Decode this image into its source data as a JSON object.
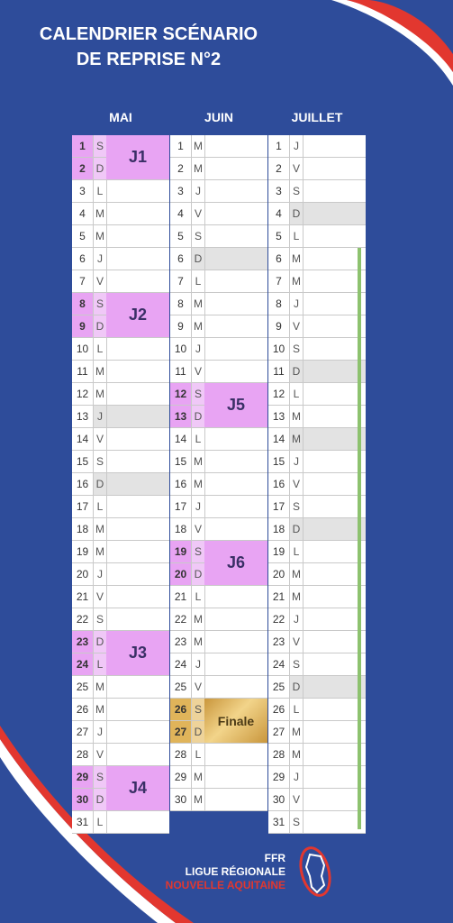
{
  "title": {
    "line1": "CALENDRIER SCÉNARIO",
    "line2": "DE REPRISE N°2"
  },
  "colors": {
    "background": "#2e4c9a",
    "event": "#e8a4f3",
    "finale": "#d9aa4e",
    "weekend_shade": "#e3e3e3",
    "holiday_bar": "#8dc26f"
  },
  "months": [
    {
      "name": "MAI",
      "days": [
        {
          "n": "1",
          "d": "S",
          "hl": true
        },
        {
          "n": "2",
          "d": "D",
          "hl": true
        },
        {
          "n": "3",
          "d": "L"
        },
        {
          "n": "4",
          "d": "M"
        },
        {
          "n": "5",
          "d": "M"
        },
        {
          "n": "6",
          "d": "J"
        },
        {
          "n": "7",
          "d": "V"
        },
        {
          "n": "8",
          "d": "S",
          "hl": true
        },
        {
          "n": "9",
          "d": "D",
          "hl": true
        },
        {
          "n": "10",
          "d": "L"
        },
        {
          "n": "11",
          "d": "M"
        },
        {
          "n": "12",
          "d": "M"
        },
        {
          "n": "13",
          "d": "J",
          "shade": true
        },
        {
          "n": "14",
          "d": "V"
        },
        {
          "n": "15",
          "d": "S"
        },
        {
          "n": "16",
          "d": "D",
          "shade": true
        },
        {
          "n": "17",
          "d": "L"
        },
        {
          "n": "18",
          "d": "M"
        },
        {
          "n": "19",
          "d": "M"
        },
        {
          "n": "20",
          "d": "J"
        },
        {
          "n": "21",
          "d": "V"
        },
        {
          "n": "22",
          "d": "S"
        },
        {
          "n": "23",
          "d": "D",
          "hl": true
        },
        {
          "n": "24",
          "d": "L",
          "hl": true
        },
        {
          "n": "25",
          "d": "M"
        },
        {
          "n": "26",
          "d": "M"
        },
        {
          "n": "27",
          "d": "J"
        },
        {
          "n": "28",
          "d": "V"
        },
        {
          "n": "29",
          "d": "S",
          "hl": true
        },
        {
          "n": "30",
          "d": "D",
          "hl": true
        },
        {
          "n": "31",
          "d": "L"
        }
      ],
      "events": [
        {
          "label": "J1",
          "start": 0
        },
        {
          "label": "J2",
          "start": 7
        },
        {
          "label": "J3",
          "start": 22
        },
        {
          "label": "J4",
          "start": 28
        }
      ]
    },
    {
      "name": "JUIN",
      "days": [
        {
          "n": "1",
          "d": "M"
        },
        {
          "n": "2",
          "d": "M"
        },
        {
          "n": "3",
          "d": "J"
        },
        {
          "n": "4",
          "d": "V"
        },
        {
          "n": "5",
          "d": "S"
        },
        {
          "n": "6",
          "d": "D",
          "shade": true
        },
        {
          "n": "7",
          "d": "L"
        },
        {
          "n": "8",
          "d": "M"
        },
        {
          "n": "9",
          "d": "M"
        },
        {
          "n": "10",
          "d": "J"
        },
        {
          "n": "11",
          "d": "V"
        },
        {
          "n": "12",
          "d": "S",
          "hl": true
        },
        {
          "n": "13",
          "d": "D",
          "hl": true
        },
        {
          "n": "14",
          "d": "L"
        },
        {
          "n": "15",
          "d": "M"
        },
        {
          "n": "16",
          "d": "M"
        },
        {
          "n": "17",
          "d": "J"
        },
        {
          "n": "18",
          "d": "V"
        },
        {
          "n": "19",
          "d": "S",
          "hl": true
        },
        {
          "n": "20",
          "d": "D",
          "hl": true
        },
        {
          "n": "21",
          "d": "L"
        },
        {
          "n": "22",
          "d": "M"
        },
        {
          "n": "23",
          "d": "M"
        },
        {
          "n": "24",
          "d": "J"
        },
        {
          "n": "25",
          "d": "V"
        },
        {
          "n": "26",
          "d": "S",
          "gold": true
        },
        {
          "n": "27",
          "d": "D",
          "gold": true
        },
        {
          "n": "28",
          "d": "L"
        },
        {
          "n": "29",
          "d": "M"
        },
        {
          "n": "30",
          "d": "M"
        }
      ],
      "events": [
        {
          "label": "J5",
          "start": 11
        },
        {
          "label": "J6",
          "start": 18
        },
        {
          "label": "Finale",
          "start": 25,
          "finale": true
        }
      ]
    },
    {
      "name": "JUILLET",
      "days": [
        {
          "n": "1",
          "d": "J"
        },
        {
          "n": "2",
          "d": "V"
        },
        {
          "n": "3",
          "d": "S"
        },
        {
          "n": "4",
          "d": "D",
          "shade": true
        },
        {
          "n": "5",
          "d": "L"
        },
        {
          "n": "6",
          "d": "M"
        },
        {
          "n": "7",
          "d": "M"
        },
        {
          "n": "8",
          "d": "J"
        },
        {
          "n": "9",
          "d": "V"
        },
        {
          "n": "10",
          "d": "S"
        },
        {
          "n": "11",
          "d": "D",
          "shade": true
        },
        {
          "n": "12",
          "d": "L"
        },
        {
          "n": "13",
          "d": "M"
        },
        {
          "n": "14",
          "d": "M",
          "shade": true
        },
        {
          "n": "15",
          "d": "J"
        },
        {
          "n": "16",
          "d": "V"
        },
        {
          "n": "17",
          "d": "S"
        },
        {
          "n": "18",
          "d": "D",
          "shade": true
        },
        {
          "n": "19",
          "d": "L"
        },
        {
          "n": "20",
          "d": "M"
        },
        {
          "n": "21",
          "d": "M"
        },
        {
          "n": "22",
          "d": "J"
        },
        {
          "n": "23",
          "d": "V"
        },
        {
          "n": "24",
          "d": "S"
        },
        {
          "n": "25",
          "d": "D",
          "shade": true
        },
        {
          "n": "26",
          "d": "L"
        },
        {
          "n": "27",
          "d": "M"
        },
        {
          "n": "28",
          "d": "M"
        },
        {
          "n": "29",
          "d": "J"
        },
        {
          "n": "30",
          "d": "V"
        },
        {
          "n": "31",
          "d": "S"
        }
      ],
      "events": []
    }
  ],
  "logo": {
    "line1": "FFR",
    "line2": "LIGUE RÉGIONALE",
    "line3": "NOUVELLE AQUITAINE",
    "emblem_icon": "rugby-ball-map-icon"
  }
}
